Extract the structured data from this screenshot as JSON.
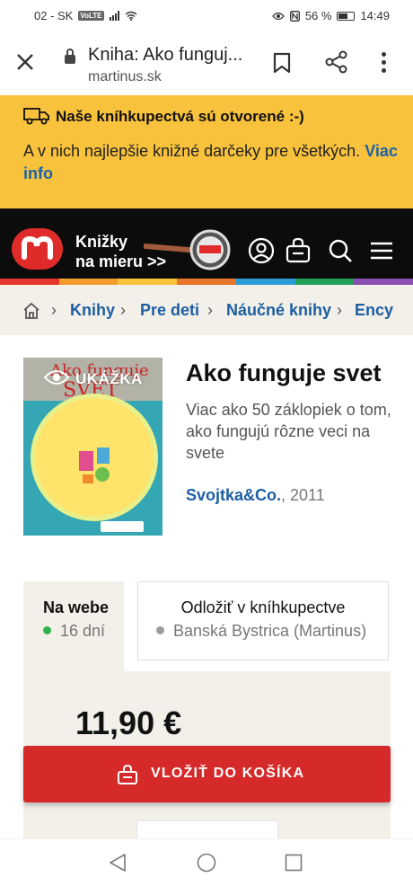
{
  "status_bar": {
    "carrier": "02 - SK",
    "volte": "VoLTE",
    "battery": "56 %",
    "time": "14:49"
  },
  "browser": {
    "title": "Kniha: Ako funguj...",
    "url": "martinus.sk"
  },
  "notice": {
    "heading": "Naše kníhkupectvá sú otvorené :-)",
    "text": "A v nich najlepšie knižné darčeky pre všetkých.",
    "link": "Viac info"
  },
  "header": {
    "tagline_1": "Knižky",
    "tagline_2": "na mieru >>"
  },
  "breadcrumb": [
    "Knihy",
    "Pre deti",
    "Náučné knihy",
    "Ency"
  ],
  "product": {
    "cover_badge": "UKÁŽKA",
    "cover_title_1": "Ako funguje",
    "cover_title_2": "SVET",
    "title": "Ako funguje svet",
    "subtitle": "Viac ako 50 záklopiek o tom, ako fungujú rôzne veci na svete",
    "publisher": "Svojtka&Co.",
    "year": ", 2011"
  },
  "availability": {
    "online_title": "Na webe",
    "online_status": "16 dní",
    "store_title": "Odložiť v kníhkupectve",
    "store_status": "Banská Bystrica (Martinus)"
  },
  "price": "11,90 €",
  "cart_button": "VLOŽIŤ DO KOŠÍKA",
  "colors": {
    "notice_bg": "#f9c23c",
    "link_blue": "#1c5fa2",
    "brand_red": "#d52a29",
    "in_stock_green": "#2eb24b",
    "store_grey": "#9a9a9a"
  }
}
